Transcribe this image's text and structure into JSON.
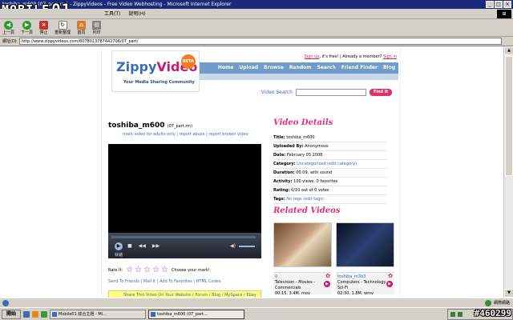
{
  "window": {
    "title": "toshiba_m600 (07_part.rm) - ZippyVideos - Free Video Webhosting - Microsoft Internet Explorer",
    "controls": [
      "_",
      "□",
      "×"
    ]
  },
  "brand_logo": {
    "text": "MOBILE",
    "suffix": "01"
  },
  "menubar": {
    "items": [
      "工具(T)",
      "說明(H)"
    ]
  },
  "toolbar": {
    "back": "上一頁",
    "forward": "下一頁",
    "stop": "停止",
    "refresh": "重新整理",
    "home": "首頁",
    "print": "列印"
  },
  "address": {
    "label": "網址(D)",
    "url": "http://www.zippyvideos.com/8078013787442706/07_part/"
  },
  "site": {
    "signup_link": "Sign up",
    "signup_suffix": ", it's free!",
    "member_prompt": "Already a member?",
    "signin_link": "Sign in",
    "logo_main": "Zippy",
    "logo_v": "Video",
    "logo_badge": "BETA",
    "tagline": "Your Media Sharing Community",
    "nav": [
      "Home",
      "Upload",
      "Browse",
      "Random",
      "Search",
      "Friend Finder",
      "Blog"
    ],
    "search_label": "Video Search",
    "search_button": "Find It"
  },
  "video": {
    "title": "toshiba_m600",
    "file": "(07_part.rm)",
    "links": [
      "mark video for adults only",
      "report abuse",
      "report broken video"
    ],
    "player_status": "就緒",
    "rate_label": "Rate It:",
    "rate_prompt": "Choose your mark!",
    "rating_stars": 5,
    "share_links": [
      "Send To Friends",
      "Mail It",
      "Add To Favorites",
      "HTML Codes"
    ],
    "share_text": "Share This Video On Your Website ( Forum / Blog / MySpace / Ebay"
  },
  "details": {
    "heading": "Video Details",
    "rows": [
      {
        "k": "Title:",
        "v": "toshiba_m600"
      },
      {
        "k": "Uploaded By:",
        "v": "Anonymous"
      },
      {
        "k": "Date:",
        "v": "February 05 2008"
      },
      {
        "k": "Category:",
        "v": "Uncategorized (edit category)"
      },
      {
        "k": "Duration:",
        "v": "00:09, with sound"
      },
      {
        "k": "Activity:",
        "v": "100 views, 0 favorites"
      },
      {
        "k": "Rating:",
        "v": "0/10 out of 0 votes"
      },
      {
        "k": "Tags:",
        "v": "No tags (edit tags)"
      }
    ]
  },
  "related": {
    "heading": "Related Videos",
    "items": [
      {
        "title": "0",
        "desc": "Television - Movies - Commercials",
        "meta": "00:15, 3.4M, mov"
      },
      {
        "title": "toshiba_m3b3",
        "desc": "Computers - Technology - Sci-Fi",
        "meta": "02:30, 1.8M, wmv"
      }
    ]
  },
  "statusbar": {
    "zone": "網際網路"
  },
  "taskbar": {
    "start": "開始",
    "tasks": [
      "Mobile01 綜合主題 - Mi...",
      "toshiba_m600 (07_part..."
    ]
  },
  "watermark": "#460299"
}
